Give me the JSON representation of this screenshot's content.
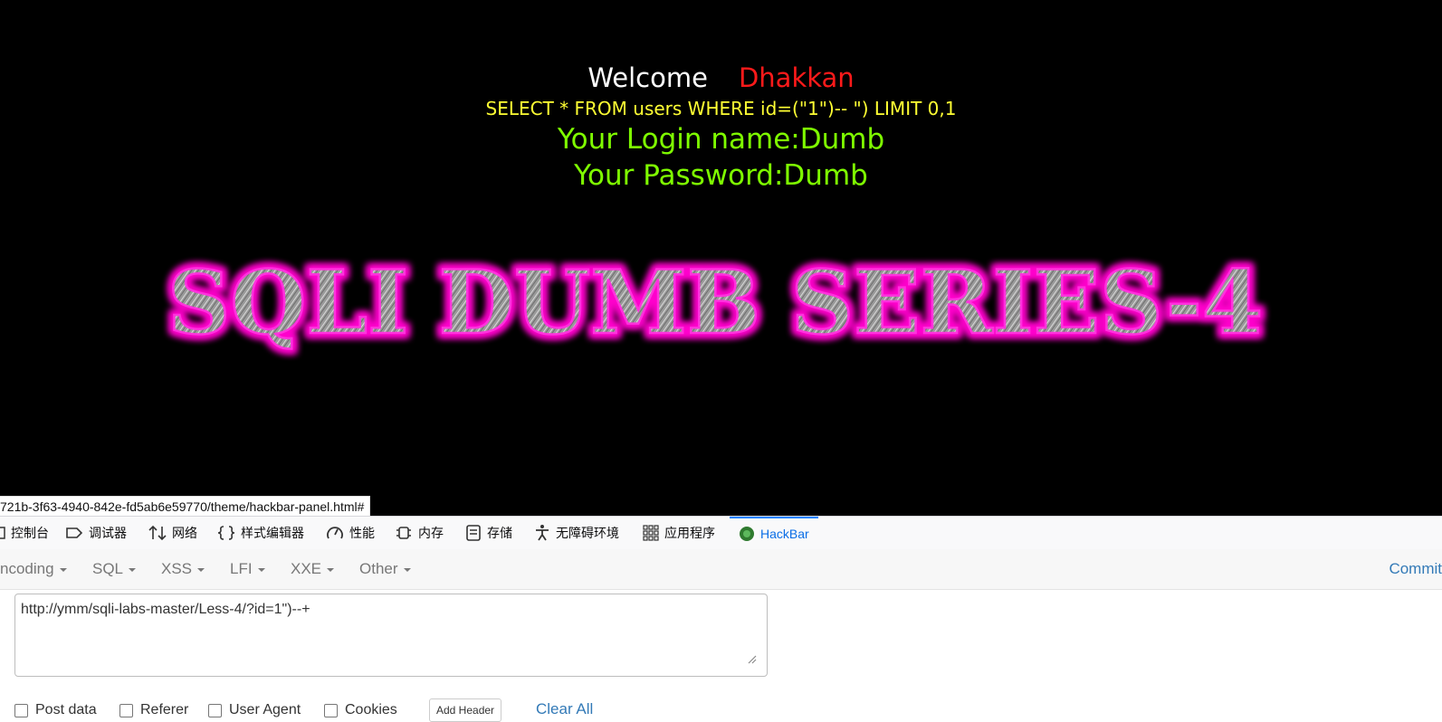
{
  "page": {
    "welcome_label": "Welcome",
    "welcome_name": "Dhakkan",
    "query": "SELECT * FROM users WHERE id=(\"1\")-- \") LIMIT 0,1",
    "login": "Your Login name:Dumb",
    "password": "Your Password:Dumb",
    "banner": "SQLI DUMB SERIES-4",
    "colors": {
      "welcome": "#ffffff",
      "name": "#ff1a1a",
      "query": "#ffff33",
      "result": "#7fff00",
      "banner_glow": "#ff00cc"
    }
  },
  "status_url": "721b-3f63-4940-842e-fd5ab6e59770/theme/hackbar-panel.html#",
  "devtools": {
    "tabs": [
      {
        "label": "控制台",
        "icon": "console-icon"
      },
      {
        "label": "调试器",
        "icon": "debugger-icon"
      },
      {
        "label": "网络",
        "icon": "network-icon"
      },
      {
        "label": "样式编辑器",
        "icon": "style-editor-icon"
      },
      {
        "label": "性能",
        "icon": "performance-icon"
      },
      {
        "label": "内存",
        "icon": "memory-icon"
      },
      {
        "label": "存储",
        "icon": "storage-icon"
      },
      {
        "label": "无障碍环境",
        "icon": "accessibility-icon"
      },
      {
        "label": "应用程序",
        "icon": "application-icon"
      },
      {
        "label": "HackBar",
        "icon": "hackbar-icon",
        "active": true
      }
    ],
    "accent": "#0a84ff"
  },
  "hackbar": {
    "menu": [
      "ncoding",
      "SQL",
      "XSS",
      "LFI",
      "XXE",
      "Other"
    ],
    "commit": "Commit",
    "url_value": "http://ymm/sqli-labs-master/Less-4/?id=1\")--+",
    "options": [
      "Post data",
      "Referer",
      "User Agent",
      "Cookies"
    ],
    "add_header": "Add Header",
    "clear_all": "Clear All"
  }
}
